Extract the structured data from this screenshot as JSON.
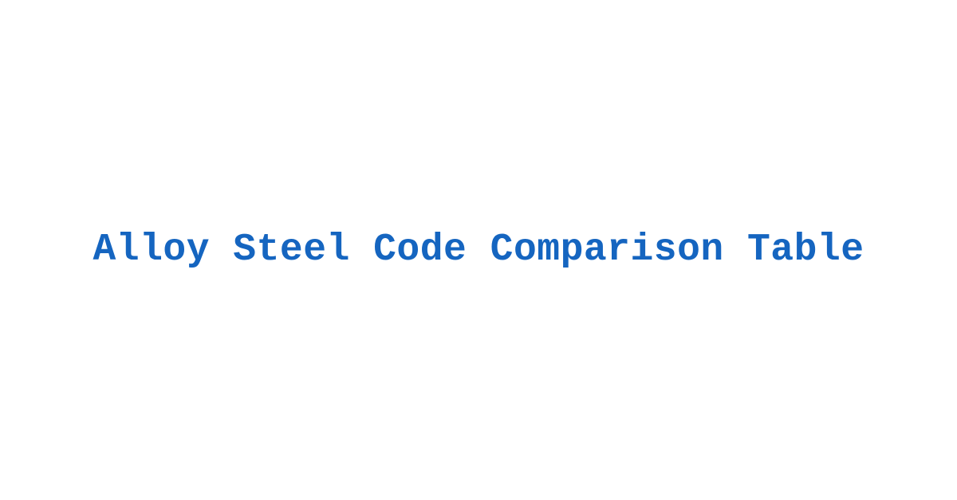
{
  "title": "Alloy Steel Code Comparison Table"
}
